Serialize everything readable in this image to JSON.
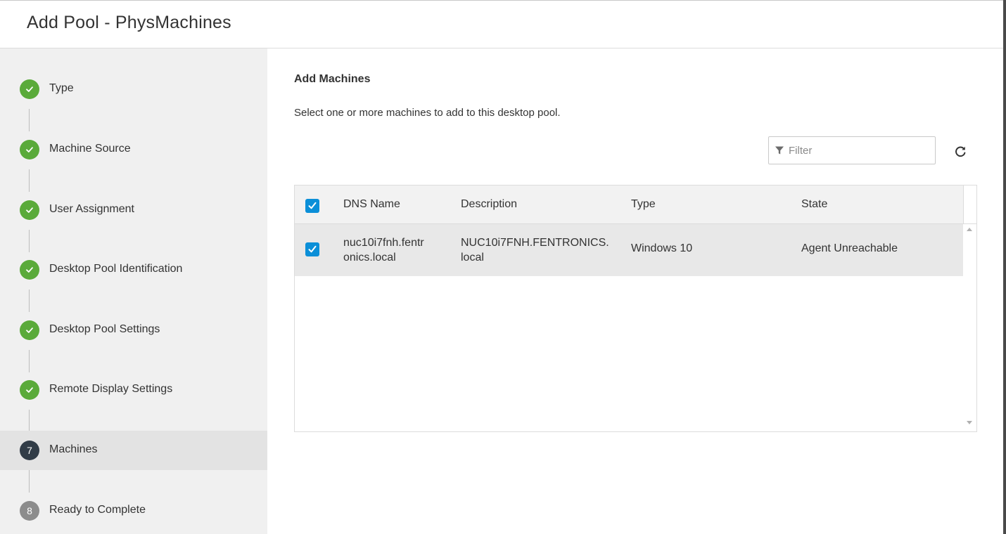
{
  "dialog": {
    "title": "Add Pool - PhysMachines"
  },
  "steps": [
    {
      "label": "Type",
      "status": "done",
      "number": "1"
    },
    {
      "label": "Machine Source",
      "status": "done",
      "number": "2"
    },
    {
      "label": "User Assignment",
      "status": "done",
      "number": "3"
    },
    {
      "label": "Desktop Pool Identification",
      "status": "done",
      "number": "4"
    },
    {
      "label": "Desktop Pool Settings",
      "status": "done",
      "number": "5"
    },
    {
      "label": "Remote Display Settings",
      "status": "done",
      "number": "6"
    },
    {
      "label": "Machines",
      "status": "current",
      "number": "7"
    },
    {
      "label": "Ready to Complete",
      "status": "future",
      "number": "8"
    }
  ],
  "main": {
    "section_title": "Add Machines",
    "description": "Select one or more machines to add to this desktop pool.",
    "filter": {
      "placeholder": "Filter",
      "value": "",
      "icon": "filter-icon"
    },
    "refresh_icon": "refresh-icon"
  },
  "table": {
    "select_all_checked": true,
    "columns": [
      "DNS Name",
      "Description",
      "Type",
      "State"
    ],
    "rows": [
      {
        "checked": true,
        "dns_name": "nuc10i7fnh.fentronics.local",
        "dns_name_lines": [
          "nuc10i7fnh.fentr",
          "onics.local"
        ],
        "description": "NUC10i7FNH.FENTRONICS.local",
        "description_lines": [
          "NUC10i7FNH.FENTRONICS.",
          "local"
        ],
        "type": "Windows 10",
        "state": "Agent Unreachable"
      }
    ]
  },
  "colors": {
    "step_done": "#5aaa3a",
    "step_current": "#313c47",
    "step_future": "#8c8c8c",
    "checkbox": "#0b8fd8",
    "sidebar_bg": "#f0f0f0",
    "active_step_bg": "#e3e3e3",
    "selected_row_bg": "#e8e8e8"
  }
}
